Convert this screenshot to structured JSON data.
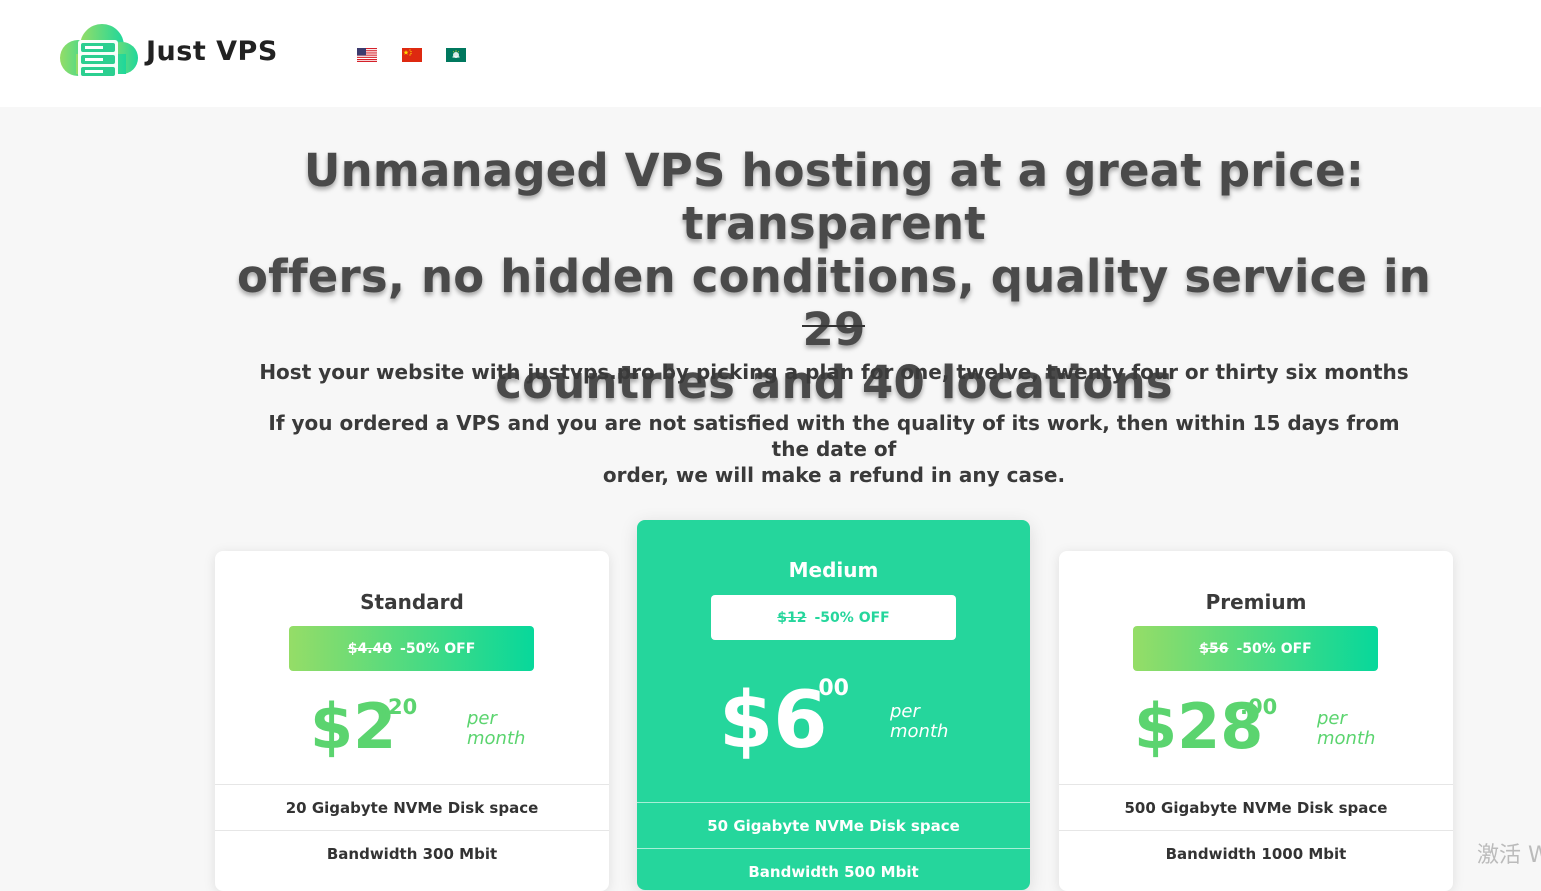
{
  "header": {
    "brand": "Just VPS",
    "languages": [
      {
        "code": "en",
        "icon": "us-flag-icon"
      },
      {
        "code": "zh",
        "icon": "china-flag-icon"
      },
      {
        "code": "mo",
        "icon": "macau-flag-icon"
      }
    ]
  },
  "hero": {
    "title_line1": "Unmanaged VPS hosting at a great price: transparent",
    "title_line2": "offers, no hidden conditions, quality service in 29",
    "title_line3": "countries and 40 locations",
    "subtitle": "Host your website with justvps.pro by picking a plan for one, twelve, twenty four or thirty six months",
    "refund_line1": "If you ordered a VPS and you are not satisfied with the quality of its work, then within 15 days from the date of",
    "refund_line2": "order, we will make a refund in any case."
  },
  "plans": [
    {
      "name": "Standard",
      "old_price": "$4.40",
      "discount": "-50% OFF",
      "price_main": "$2",
      "price_cents": ".20",
      "per": "per",
      "month": "month",
      "features": [
        "20 Gigabyte NVMe Disk space",
        "Bandwidth 300 Mbit"
      ]
    },
    {
      "name": "Medium",
      "old_price": "$12",
      "discount": "-50% OFF",
      "price_main": "$6",
      "price_cents": ".00",
      "per": "per",
      "month": "month",
      "features": [
        "50 Gigabyte NVMe Disk space",
        "Bandwidth 500 Mbit"
      ]
    },
    {
      "name": "Premium",
      "old_price": "$56",
      "discount": "-50% OFF",
      "price_main": "$28",
      "price_cents": ".00",
      "per": "per",
      "month": "month",
      "features": [
        "500 Gigabyte NVMe Disk space",
        "Bandwidth 1000 Mbit"
      ]
    }
  ],
  "colors": {
    "accent": "#25d69c",
    "price_green": "#5bd46f",
    "gradient_start": "#95dd67",
    "gradient_end": "#07d89b"
  },
  "watermark": "激活 W"
}
